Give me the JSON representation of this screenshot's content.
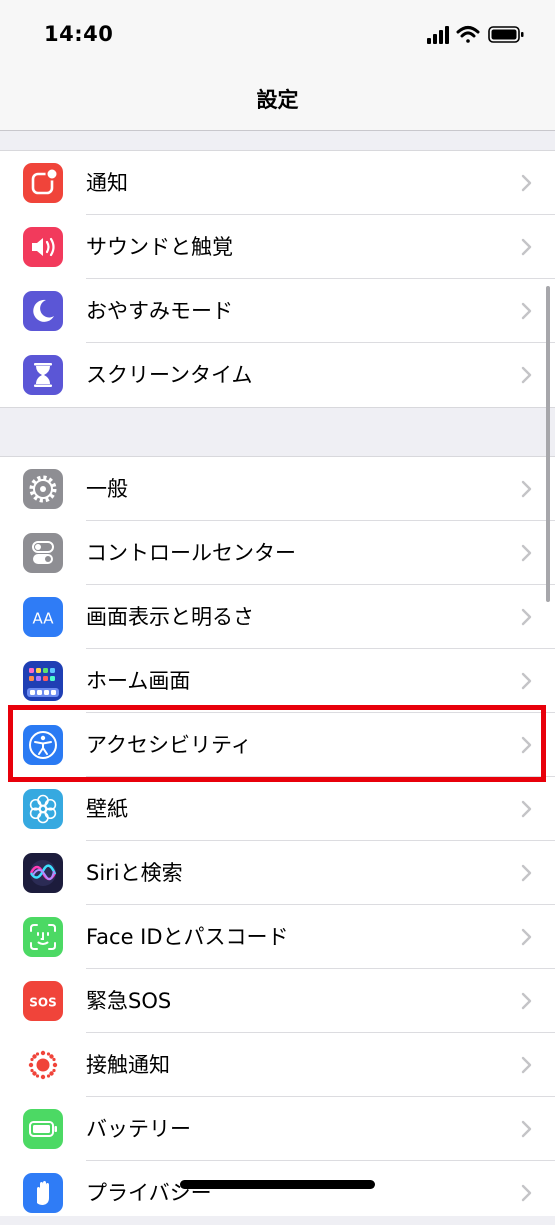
{
  "status_bar": {
    "time": "14:40"
  },
  "nav": {
    "title": "設定"
  },
  "groups": [
    {
      "items": [
        {
          "label": "通知",
          "icon": "notifications-icon",
          "color": "#f0443a"
        },
        {
          "label": "サウンドと触覚",
          "icon": "speaker-icon",
          "color": "#f23a5c"
        },
        {
          "label": "おやすみモード",
          "icon": "moon-icon",
          "color": "#5b56d6"
        },
        {
          "label": "スクリーンタイム",
          "icon": "hourglass-icon",
          "color": "#5b56d6"
        }
      ]
    },
    {
      "items": [
        {
          "label": "一般",
          "icon": "gear-icon",
          "color": "#8e8e93"
        },
        {
          "label": "コントロールセンター",
          "icon": "toggle-switches-icon",
          "color": "#8e8e93"
        },
        {
          "label": "画面表示と明るさ",
          "icon": "text-size-icon",
          "color": "#2f7cf6",
          "glyph": "AA"
        },
        {
          "label": "ホーム画面",
          "icon": "home-screen-grid-icon",
          "color": "#2a57d8"
        },
        {
          "label": "アクセシビリティ",
          "icon": "accessibility-icon",
          "color": "#2a7af3"
        },
        {
          "label": "壁紙",
          "icon": "wallpaper-flower-icon",
          "color": "#36a9e0"
        },
        {
          "label": "Siriと検索",
          "icon": "siri-icon",
          "color": "#1c1c3c"
        },
        {
          "label": "Face IDとパスコード",
          "icon": "face-id-icon",
          "color": "#4cd964"
        },
        {
          "label": "緊急SOS",
          "icon": "sos-icon",
          "color": "#f0443a",
          "glyph": "SOS"
        },
        {
          "label": "接触通知",
          "icon": "exposure-notification-icon",
          "color": "#f0443a"
        },
        {
          "label": "バッテリー",
          "icon": "battery-icon",
          "color": "#4cd964"
        },
        {
          "label": "プライバシー",
          "icon": "hand-icon",
          "color": "#2f7cf6"
        }
      ]
    }
  ],
  "highlight_target": "アクセシビリティ"
}
